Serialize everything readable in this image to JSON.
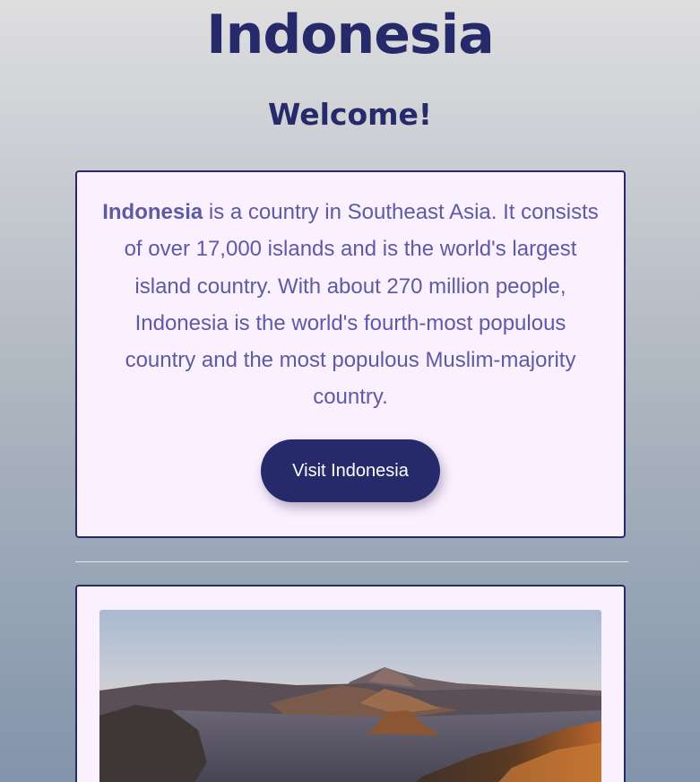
{
  "header": {
    "title": "Indonesia",
    "welcome": "Welcome!"
  },
  "intro": {
    "lead": "Indonesia",
    "body": " is a country in Southeast Asia. It consists of over 17,000 islands and is the world's largest island country. With about 270 million people, Indonesia is the world's fourth-most populous country and the most populous Muslim-majority country.",
    "button_label": "Visit Indonesia"
  },
  "colors": {
    "primary": "#262a6a",
    "card_background": "#fbf0fe",
    "text_accent": "#5d5aa6"
  },
  "photo": {
    "subject": "volcanic-landscape-at-sunrise"
  }
}
